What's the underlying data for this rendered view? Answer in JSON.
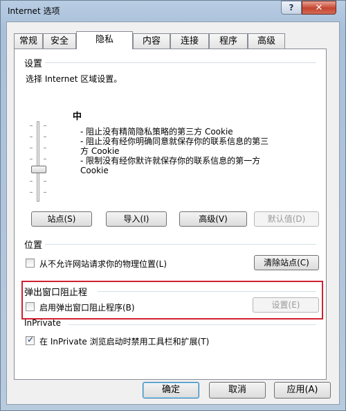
{
  "window": {
    "title": "Internet 选项",
    "help_label": "?",
    "close_label": "✕"
  },
  "tabs": [
    "常规",
    "安全",
    "隐私",
    "内容",
    "连接",
    "程序",
    "高级"
  ],
  "active_tab": "隐私",
  "settings": {
    "group_label": "设置",
    "zone_prompt": "选择 Internet 区域设置。",
    "level": "中",
    "description": [
      "- 阻止没有精简隐私策略的第三方 Cookie",
      "- 阻止没有经你明确同意就保存你的联系信息的第三",
      "方 Cookie",
      "- 限制没有经你默许就保存你的联系信息的第一方",
      "Cookie"
    ],
    "slider_value": "中",
    "buttons": {
      "sites": "站点(S)",
      "import": "导入(I)",
      "advanced": "高级(V)",
      "default": "默认值(D)"
    }
  },
  "location": {
    "group_label": "位置",
    "checkbox_label": "从不允许网站请求你的物理位置(L)",
    "checked": false,
    "clear_button": "清除站点(C)"
  },
  "popup": {
    "group_label": "弹出窗口阻止程",
    "checkbox_label": "启用弹出窗口阻止程序(B)",
    "checked": false,
    "settings_button": "设置(E)"
  },
  "inprivate": {
    "group_label": "InPrivate",
    "checkbox_label": "在 InPrivate 浏览启动时禁用工具栏和扩展(T)",
    "checked": true
  },
  "footer": {
    "ok": "确定",
    "cancel": "取消",
    "apply": "应用(A)"
  },
  "colors": {
    "highlight_box": "#d02030",
    "window_frame": "#b9cde3",
    "close_button": "#c5452f"
  },
  "icons": {
    "help": "question-mark-icon",
    "close": "close-icon",
    "check": "checkmark-icon"
  }
}
